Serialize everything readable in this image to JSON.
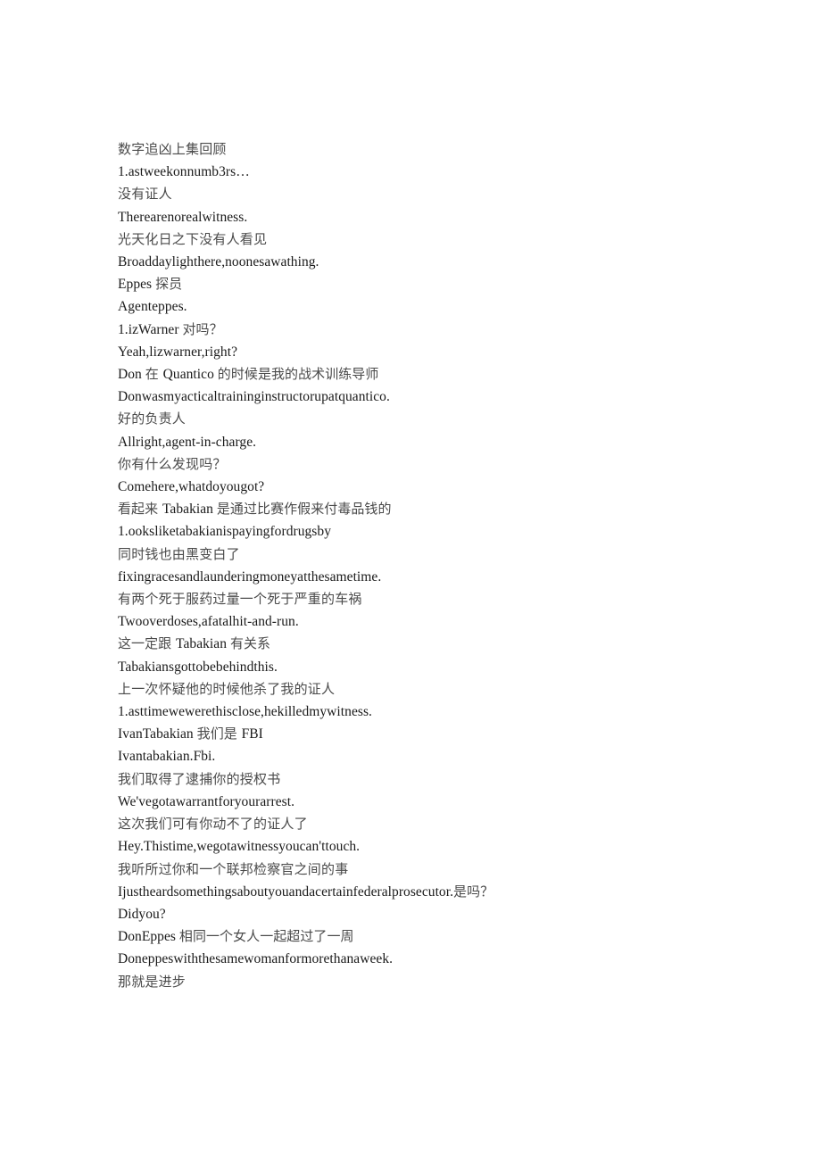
{
  "document": {
    "title": "数字追凶上集回顾",
    "background_color": "#ffffff",
    "cjk_text_color": "#4a4a4a",
    "latin_text_color": "#1a1a1a",
    "lines": [
      {
        "kind": "cn",
        "text": "数字追凶上集回顾"
      },
      {
        "kind": "en",
        "text": "1.astweekonnumb3rs…"
      },
      {
        "kind": "cn",
        "text": "没有证人"
      },
      {
        "kind": "en",
        "text": "Therearenorealwitness."
      },
      {
        "kind": "cn",
        "text": "光天化日之下没有人看见"
      },
      {
        "kind": "en",
        "text": "Broaddaylighthere,noonesawathing."
      },
      {
        "kind": "mix",
        "parts": [
          {
            "t": "Eppes ",
            "cjk": false
          },
          {
            "t": "探员",
            "cjk": true
          }
        ]
      },
      {
        "kind": "en",
        "text": "Agenteppes."
      },
      {
        "kind": "mix",
        "parts": [
          {
            "t": "1.izWarner ",
            "cjk": false
          },
          {
            "t": "对吗？",
            "cjk": true
          }
        ]
      },
      {
        "kind": "en",
        "text": "Yeah,lizwarner,right?"
      },
      {
        "kind": "mix",
        "parts": [
          {
            "t": "Don ",
            "cjk": false
          },
          {
            "t": "在 ",
            "cjk": true
          },
          {
            "t": "Quantico ",
            "cjk": false
          },
          {
            "t": "的时候是我的战术训练导师",
            "cjk": true
          }
        ]
      },
      {
        "kind": "en",
        "text": "Donwasmyacticaltraininginstructorupatquantico."
      },
      {
        "kind": "cn",
        "text": "好的负责人"
      },
      {
        "kind": "en",
        "text": "Allright,agent-in-charge."
      },
      {
        "kind": "cn",
        "text": "你有什么发现吗？"
      },
      {
        "kind": "en",
        "text": "Comehere,whatdoyougot?"
      },
      {
        "kind": "mix",
        "parts": [
          {
            "t": "看起来 ",
            "cjk": true
          },
          {
            "t": "Tabakian ",
            "cjk": false
          },
          {
            "t": "是通过比赛作假来付毒品钱的",
            "cjk": true
          }
        ]
      },
      {
        "kind": "en",
        "text": "1.ooksliketabakianispayingfordrugsby"
      },
      {
        "kind": "cn",
        "text": "同时钱也由黑变白了"
      },
      {
        "kind": "en",
        "text": "fixingracesandlaunderingmoneyatthesametime."
      },
      {
        "kind": "cn",
        "text": "有两个死于服药过量一个死于严重的车祸"
      },
      {
        "kind": "en",
        "text": "Twooverdoses,afatalhit-and-run."
      },
      {
        "kind": "mix",
        "parts": [
          {
            "t": "这一定跟 ",
            "cjk": true
          },
          {
            "t": "Tabakian ",
            "cjk": false
          },
          {
            "t": "有关系",
            "cjk": true
          }
        ]
      },
      {
        "kind": "en",
        "text": "Tabakiansgottobebehindthis."
      },
      {
        "kind": "cn",
        "text": "上一次怀疑他的时候他杀了我的证人"
      },
      {
        "kind": "en",
        "text": "1.asttimewewerethisclose,hekilledmywitness."
      },
      {
        "kind": "mix",
        "parts": [
          {
            "t": "IvanTabakian ",
            "cjk": false
          },
          {
            "t": "我们是 ",
            "cjk": true
          },
          {
            "t": "FBI",
            "cjk": false
          }
        ]
      },
      {
        "kind": "en",
        "text": "Ivantabakian.Fbi."
      },
      {
        "kind": "cn",
        "text": "我们取得了逮捕你的授权书"
      },
      {
        "kind": "en",
        "text": "We'vegotawarrantforyourarrest."
      },
      {
        "kind": "cn",
        "text": "这次我们可有你动不了的证人了"
      },
      {
        "kind": "en",
        "text": "Hey.Thistime,wegotawitnessyoucan'ttouch."
      },
      {
        "kind": "cn",
        "text": "我听所过你和一个联邦检察官之间的事"
      },
      {
        "kind": "mix",
        "parts": [
          {
            "t": "Ijustheardsomethingsaboutyouandacertainfederalprosecutor.",
            "cjk": false
          },
          {
            "t": "是吗？",
            "cjk": true
          }
        ]
      },
      {
        "kind": "en",
        "text": "Didyou?"
      },
      {
        "kind": "mix",
        "parts": [
          {
            "t": "DonEppes ",
            "cjk": false
          },
          {
            "t": "相同一个女人一起超过了一周",
            "cjk": true
          }
        ]
      },
      {
        "kind": "en",
        "text": "Doneppeswiththesamewomanformorethanaweek."
      },
      {
        "kind": "cn",
        "text": "那就是进步"
      }
    ]
  }
}
